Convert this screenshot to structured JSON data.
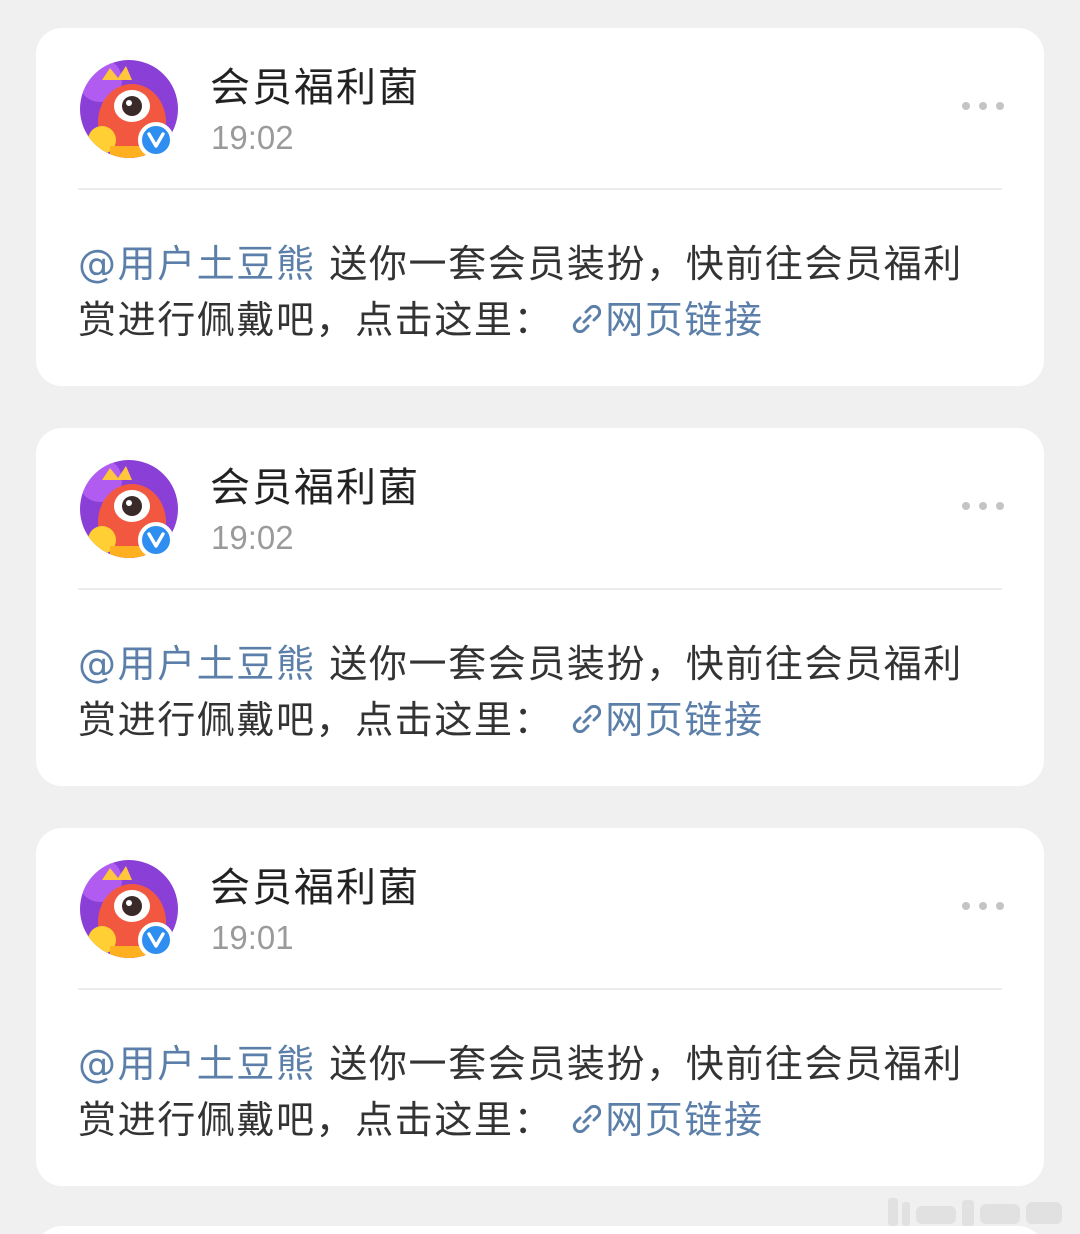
{
  "posts": [
    {
      "author": "会员福利菌",
      "time": "19:02",
      "mention": "@用户土豆熊",
      "message": " 送你一套会员装扮，快前往会员福利赏进行佩戴吧，点击这里：",
      "link_label": "网页链接"
    },
    {
      "author": "会员福利菌",
      "time": "19:02",
      "mention": "@用户土豆熊",
      "message": " 送你一套会员装扮，快前往会员福利赏进行佩戴吧，点击这里：",
      "link_label": "网页链接"
    },
    {
      "author": "会员福利菌",
      "time": "19:01",
      "mention": "@用户土豆熊",
      "message": " 送你一套会员装扮，快前往会员福利赏进行佩戴吧，点击这里：",
      "link_label": "网页链接"
    }
  ],
  "icons": {
    "avatar": "mascot-avatar",
    "badge": "verified-v-icon",
    "more": "more-dots-icon",
    "link": "link-chain-icon"
  },
  "colors": {
    "background": "#f0f0f0",
    "card": "#ffffff",
    "mention_link": "#5b7fa8",
    "verified_badge": "#2f8ff0",
    "time": "#9a9a9a"
  }
}
